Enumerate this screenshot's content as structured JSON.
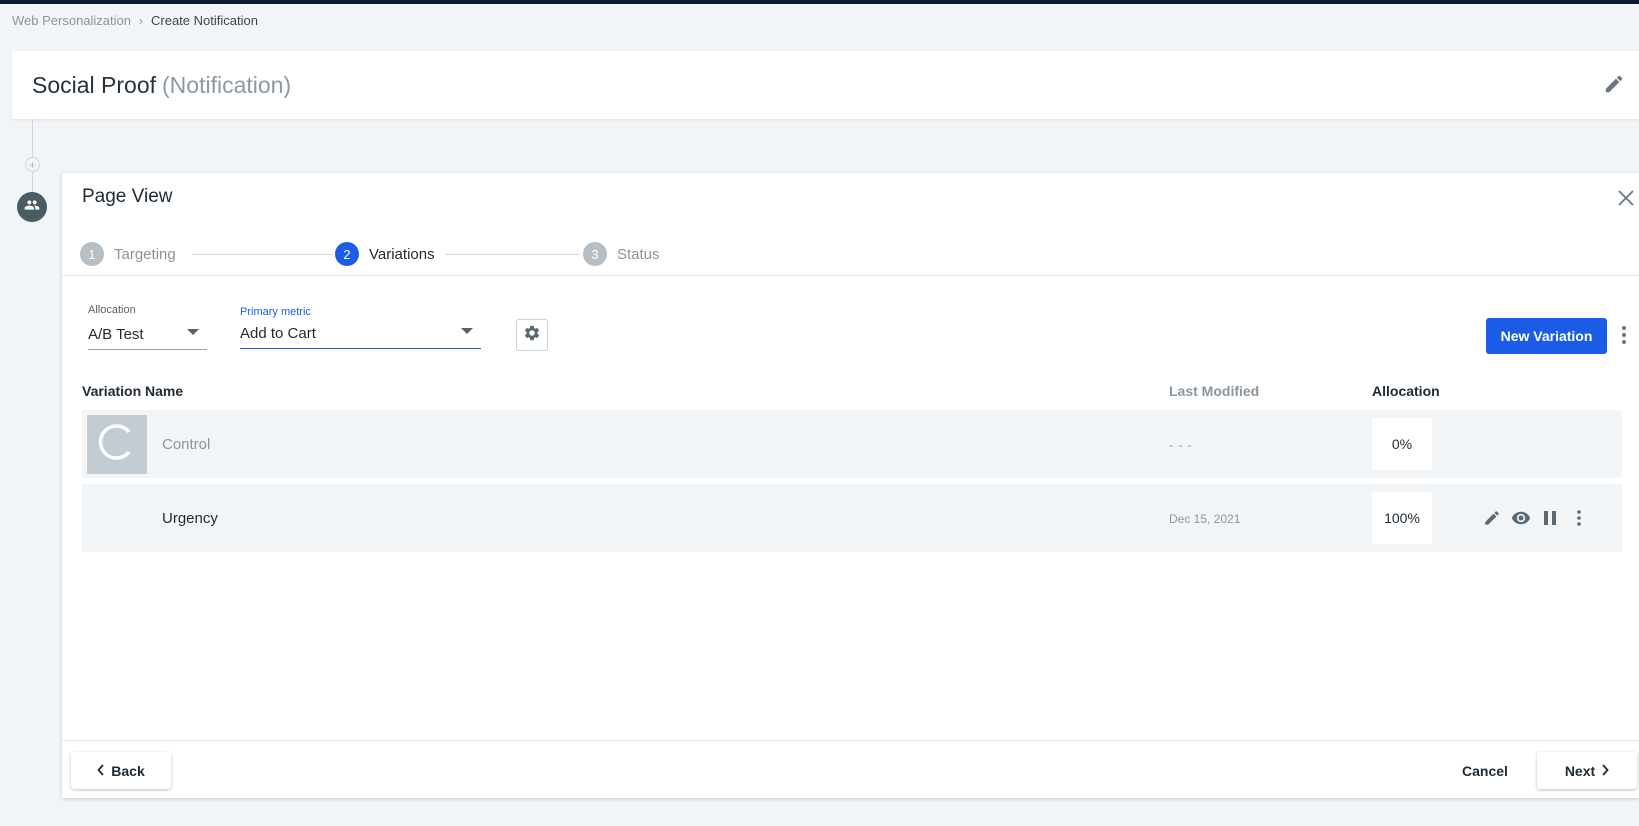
{
  "breadcrumb": {
    "parent": "Web Personalization",
    "separator": "›",
    "current": "Create Notification"
  },
  "header": {
    "title": "Social Proof",
    "subtitle": "(Notification)"
  },
  "panel": {
    "title": "Page View",
    "steps": [
      {
        "num": "1",
        "label": "Targeting",
        "state": "inactive"
      },
      {
        "num": "2",
        "label": "Variations",
        "state": "active"
      },
      {
        "num": "3",
        "label": "Status",
        "state": "inactive"
      }
    ],
    "allocation_field": {
      "label": "Allocation",
      "value": "A/B Test"
    },
    "metric_field": {
      "label": "Primary metric",
      "value": "Add to Cart"
    },
    "new_variation_label": "New Variation",
    "table": {
      "headers": {
        "name": "Variation Name",
        "modified": "Last Modified",
        "allocation": "Allocation"
      },
      "rows": [
        {
          "thumb_letter": "C",
          "name": "Control",
          "modified": "- - -",
          "allocation": "0%"
        },
        {
          "name": "Urgency",
          "modified": "Dec 15, 2021",
          "allocation": "100%"
        }
      ]
    },
    "footer": {
      "back": "Back",
      "cancel": "Cancel",
      "next": "Next"
    }
  },
  "colors": {
    "primary": "#1a5ce6",
    "node": "#4a5b66",
    "row_bg": "#f2f5f8",
    "topbar": "#0e1a2b"
  },
  "icons": [
    "pencil-icon",
    "close-icon",
    "users-icon",
    "plus-circle-icon",
    "gear-icon",
    "kebab-icon",
    "eye-icon",
    "pause-icon",
    "chevron-left-icon",
    "chevron-right-icon"
  ]
}
